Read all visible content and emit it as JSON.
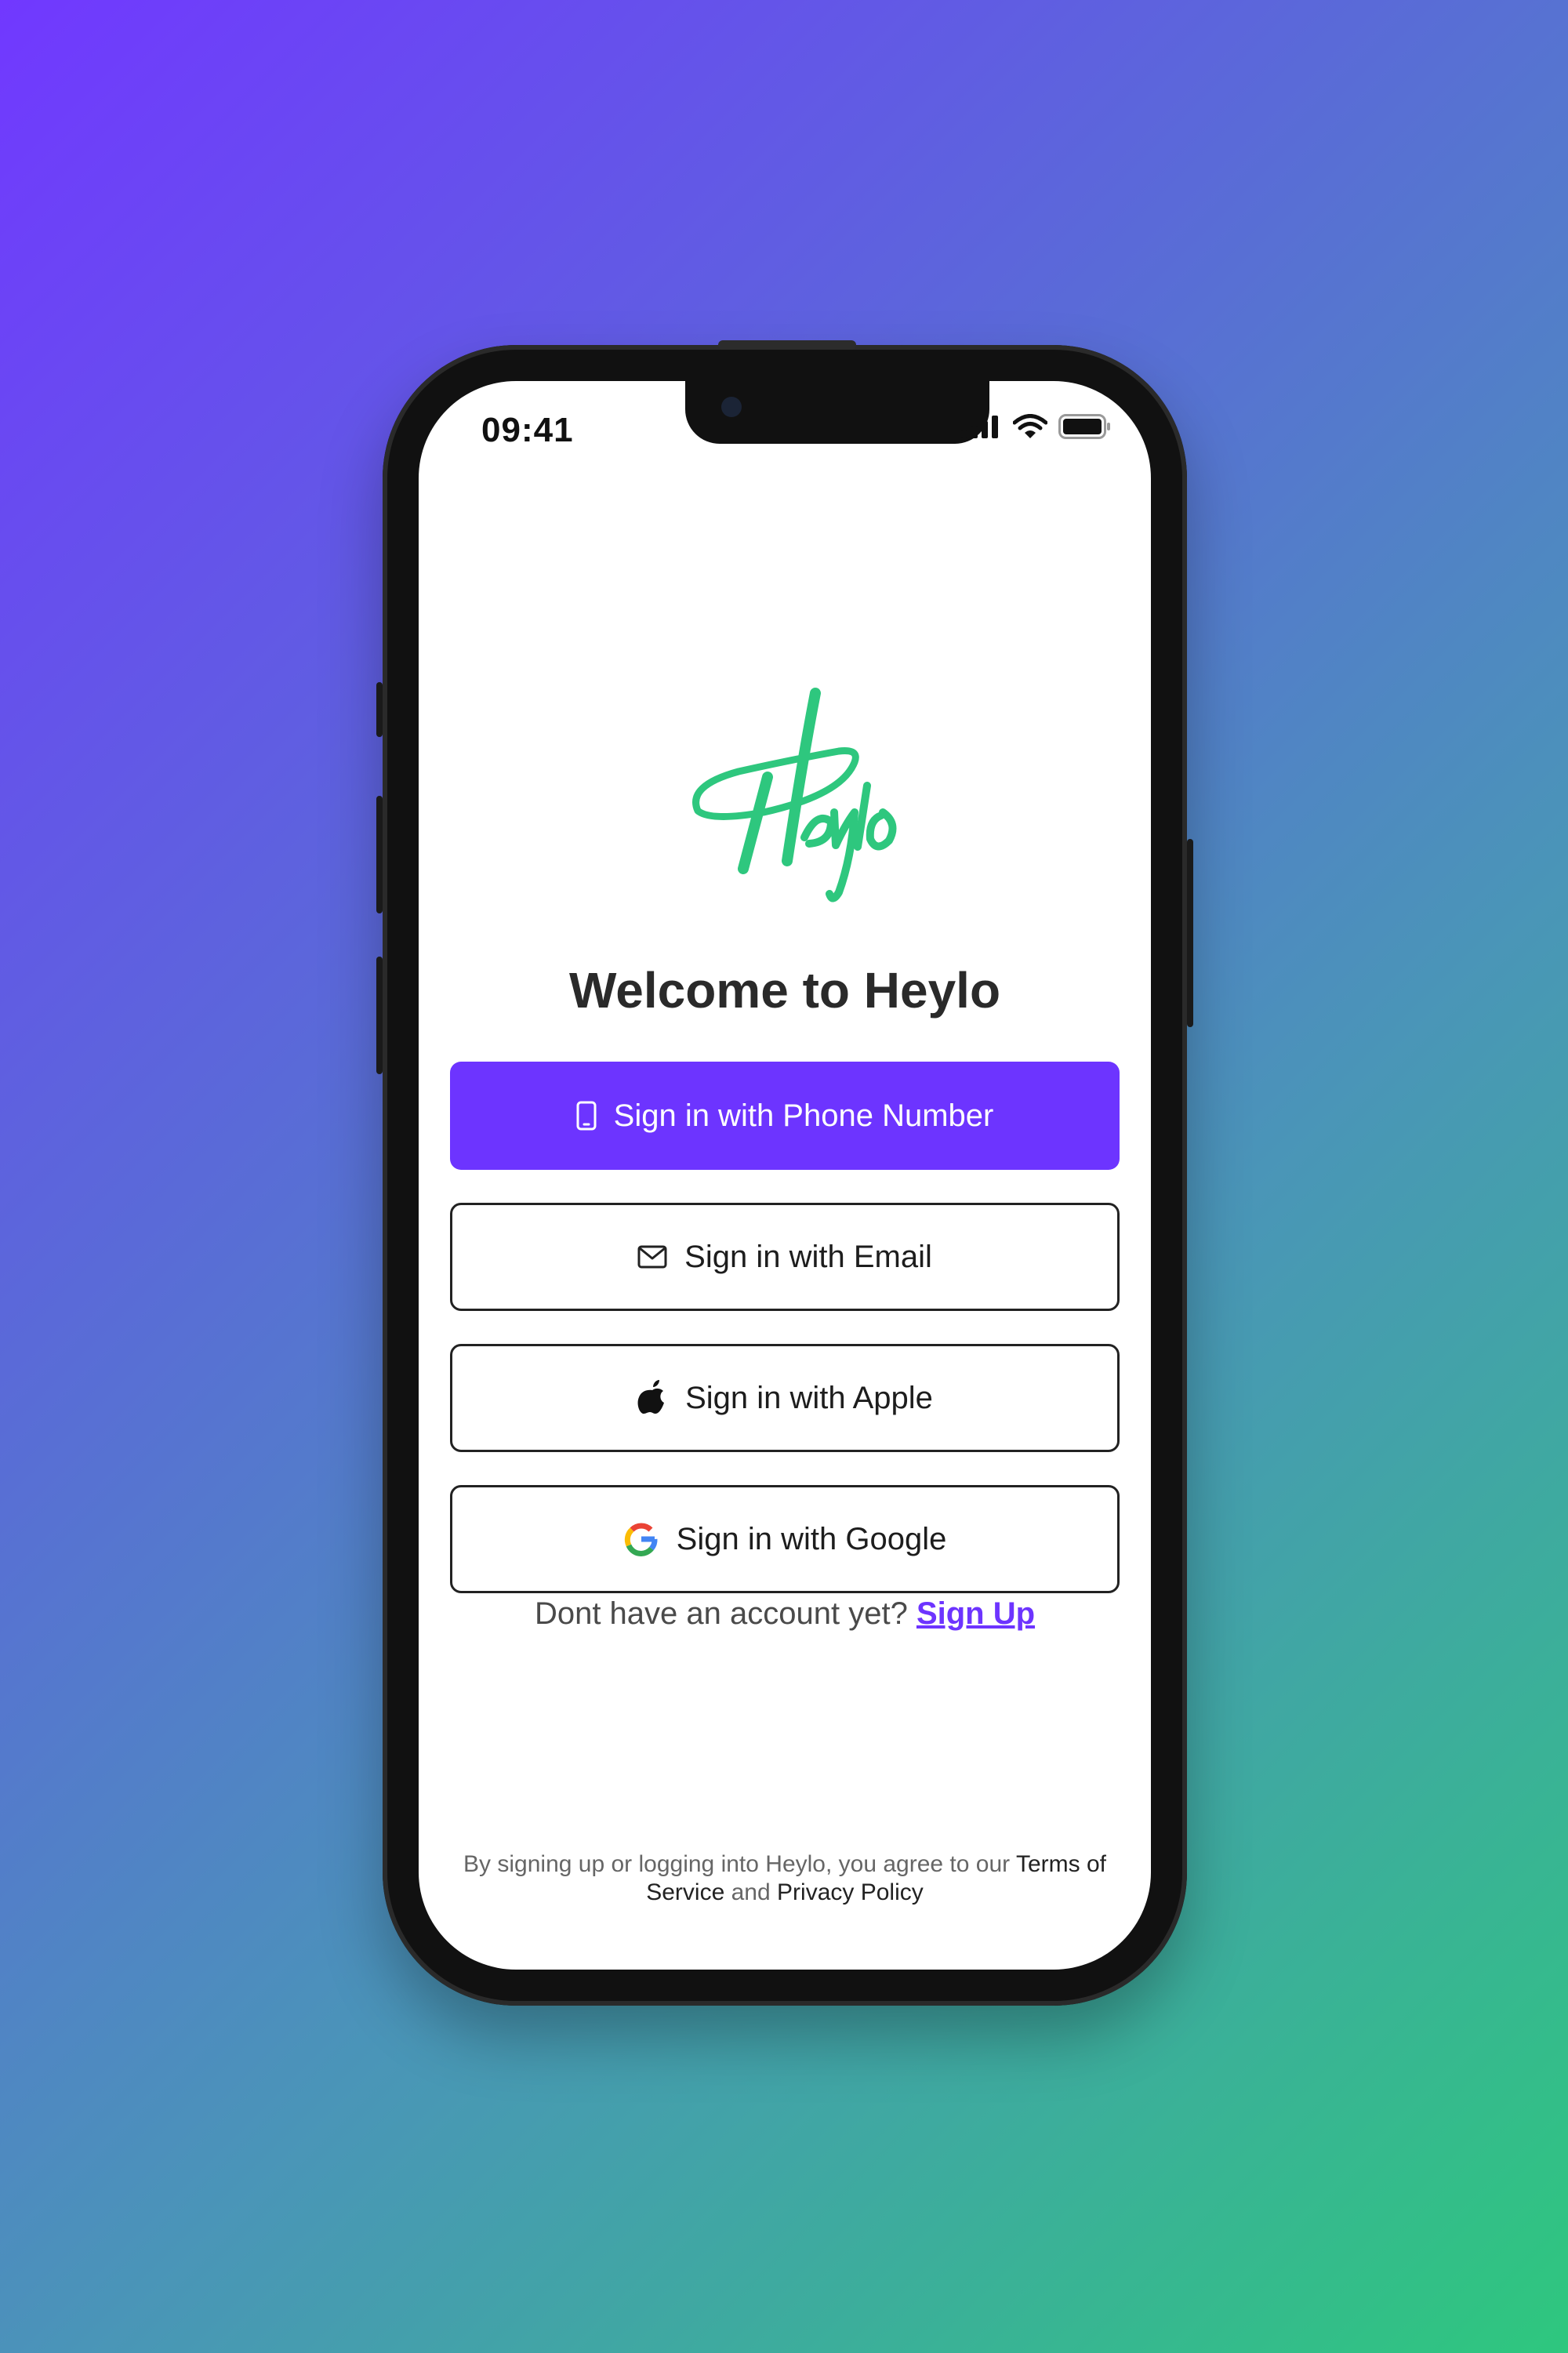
{
  "status_bar": {
    "time": "09:41"
  },
  "brand": {
    "logo_text": "Heylo",
    "logo_color": "#2ec77e"
  },
  "welcome": {
    "title": "Welcome to Heylo"
  },
  "buttons": {
    "phone": {
      "label": "Sign in with Phone Number",
      "icon": "phone-icon"
    },
    "email": {
      "label": "Sign in with Email",
      "icon": "mail-icon"
    },
    "apple": {
      "label": "Sign in with Apple",
      "icon": "apple-icon"
    },
    "google": {
      "label": "Sign in with Google",
      "icon": "google-icon"
    }
  },
  "signup": {
    "prompt": "Dont have an account yet?",
    "link_label": "Sign Up"
  },
  "legal": {
    "prefix": "By signing up or logging into Heylo, you agree to our",
    "terms": "Terms of Service",
    "and": "and",
    "privacy": "Privacy Policy"
  },
  "colors": {
    "accent": "#6d34ff",
    "brand_green": "#2ec77e"
  }
}
